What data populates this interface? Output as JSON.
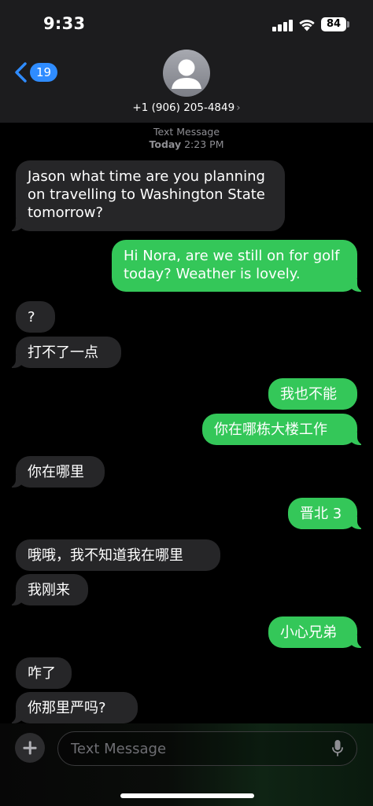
{
  "status_bar": {
    "time": "9:33",
    "battery": "84"
  },
  "header": {
    "back_count": "19",
    "contact": "+1 (906) 205-4849",
    "chevron": "›"
  },
  "thread": {
    "service": "Text Message",
    "date_day": "Today",
    "date_time": "2:23 PM"
  },
  "messages": [
    {
      "dir": "in",
      "text": "Jason what time are you planning on travelling to Washington State tomorrow?"
    },
    {
      "dir": "out",
      "text": "Hi Nora, are we still on for golf today?  Weather is lovely."
    },
    {
      "dir": "in",
      "text": "?"
    },
    {
      "dir": "in",
      "text": "打不了一点"
    },
    {
      "dir": "out",
      "text": "我也不能"
    },
    {
      "dir": "out",
      "text": "你在哪栋大楼工作"
    },
    {
      "dir": "in",
      "text": "你在哪里"
    },
    {
      "dir": "out",
      "text": "晋北 3"
    },
    {
      "dir": "in",
      "text": "哦哦，我不知道我在哪里"
    },
    {
      "dir": "in",
      "text": "我刚来"
    },
    {
      "dir": "out",
      "text": "小心兄弟"
    },
    {
      "dir": "in",
      "text": "咋了"
    },
    {
      "dir": "in",
      "text": "你那里严吗?"
    }
  ],
  "composer": {
    "placeholder": "Text Message"
  },
  "icons": {
    "back": "chevron-left-icon",
    "avatar": "person-icon",
    "add": "plus-icon",
    "mic": "microphone-icon"
  },
  "colors": {
    "incoming": "#262628",
    "outgoing": "#34c759",
    "badge": "#2f8cff"
  }
}
